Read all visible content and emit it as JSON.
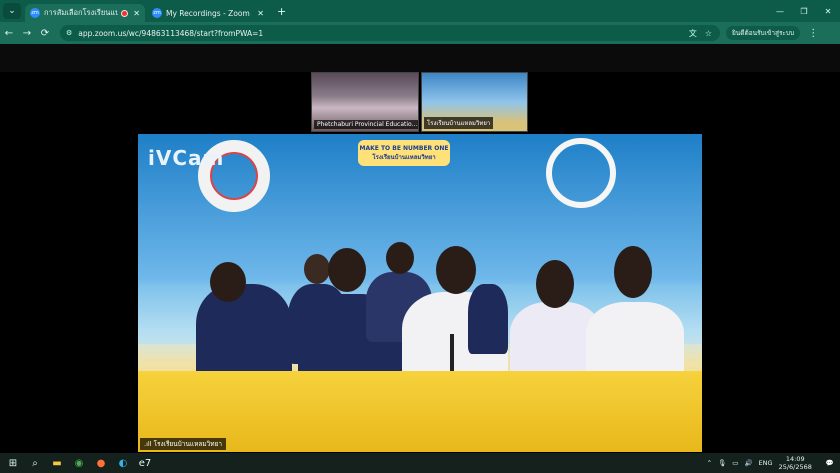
{
  "browser": {
    "tabs": [
      {
        "title": "การสัมเลือกโรงเรียนแบบอย่างฯ",
        "active": true,
        "recording": true
      },
      {
        "title": "My Recordings - Zoom",
        "active": false
      }
    ],
    "new_tab": "+",
    "url": "app.zoom.us/wc/94863113468/start?fromPWA=1",
    "profile_label": "ยินดีต้อนรับเข้าสู่ระบบ",
    "nav": {
      "back": "←",
      "forward": "→",
      "reload": "⟳"
    },
    "window_controls": {
      "minimize": "—",
      "maximize": "❐",
      "close": "✕"
    }
  },
  "zoom": {
    "thumbnails": [
      {
        "label": "Phetchaburi Provincial Educatio..."
      },
      {
        "label": "โรงเรียนบ้านแหลมวิทยา"
      }
    ],
    "main_video": {
      "watermark": "iVCam",
      "banner_line1": "MAKE TO BE NUMBER ONE",
      "banner_line2": "โรงเรียนบ้านแหลมวิทยา",
      "speaker_label": "โรงเรียนบ้านแหลมวิทยา"
    }
  },
  "taskbar": {
    "apps": [
      "windows-start",
      "search",
      "file-explorer",
      "chrome",
      "firefox",
      "edge",
      "zoom-app"
    ],
    "language": "ENG",
    "time": "14:09",
    "date": "25/6/2568"
  },
  "colors": {
    "chrome_tabbar": "#0d5c4a",
    "chrome_toolbar": "#1a6e5a",
    "taskbar": "#14211d"
  }
}
